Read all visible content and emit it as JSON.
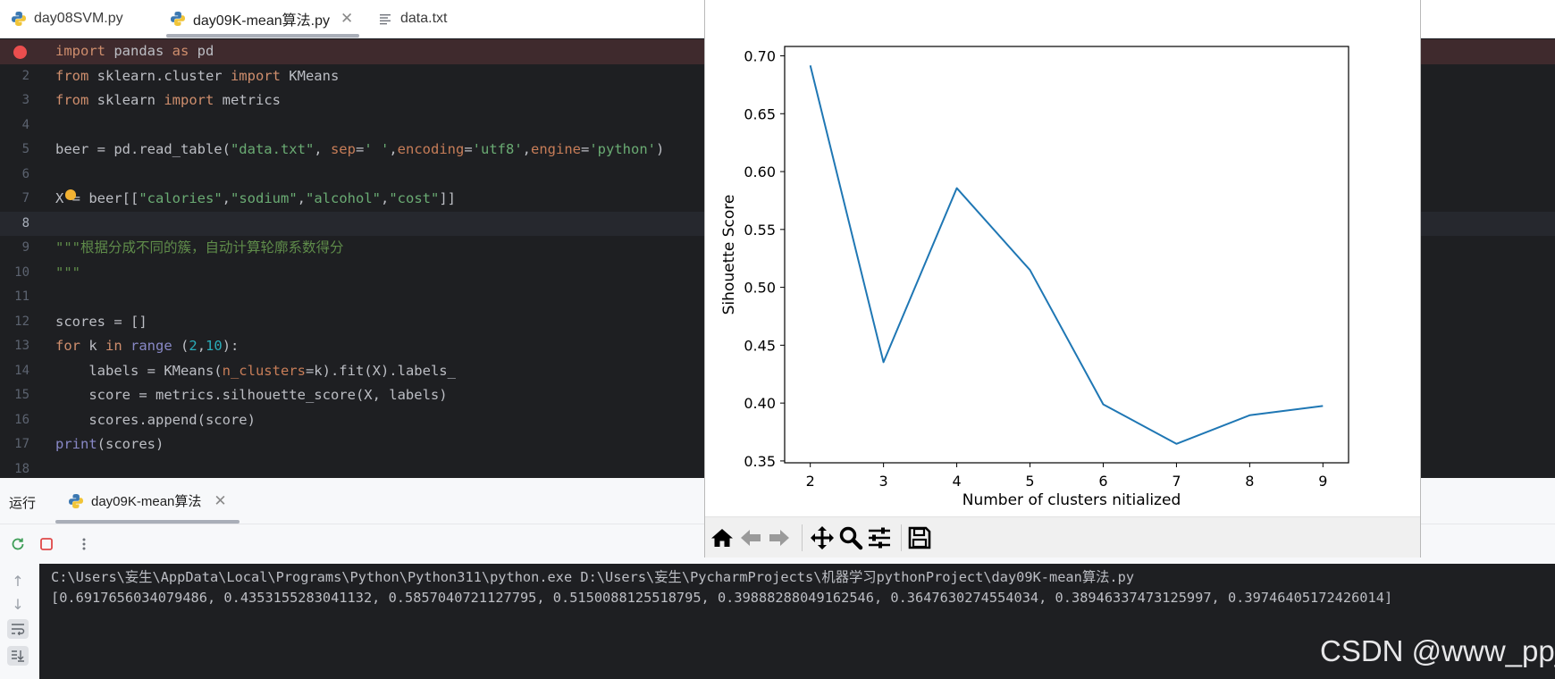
{
  "tabs": [
    {
      "label": "day08SVM.py",
      "icon": "python-file-icon",
      "active": false
    },
    {
      "label": "day09K-mean算法.py",
      "icon": "python-file-icon",
      "active": true
    },
    {
      "label": "data.txt",
      "icon": "text-file-icon",
      "active": false
    }
  ],
  "editor": {
    "line_numbers": [
      "2",
      "3",
      "4",
      "5",
      "6",
      "7",
      "8",
      "9",
      "10",
      "11",
      "12",
      "13",
      "14",
      "15",
      "16",
      "17",
      "18"
    ],
    "breakpoint_line": 1,
    "current_line": 8
  },
  "run_panel": {
    "title": "运行",
    "tab_label": "day09K-mean算法",
    "console": [
      "C:\\Users\\妄生\\AppData\\Local\\Programs\\Python\\Python311\\python.exe D:\\Users\\妄生\\PycharmProjects\\机器学习pythonProject\\day09K-mean算法.py",
      "[0.6917656034079486, 0.4353155283041132, 0.5857040721127795, 0.5150088125518795, 0.39888288049162546, 0.3647630274554034, 0.38946337473125997, 0.39746405172426014]"
    ]
  },
  "watermark": "CSDN @www_pp_",
  "colors": {
    "line_color": "#1f77b4",
    "breakpoint": "#ea4e4e",
    "keyword": "#cf8e6d",
    "string": "#6aab73"
  },
  "chart_data": {
    "type": "line",
    "xlabel": "Number of clusters nitialized",
    "ylabel": "Sihouette Score",
    "x": [
      2,
      3,
      4,
      5,
      6,
      7,
      8,
      9
    ],
    "y": [
      0.6917656034079486,
      0.4353155283041132,
      0.5857040721127795,
      0.5150088125518795,
      0.39888288049162546,
      0.3647630274554034,
      0.38946337473125997,
      0.39746405172426014
    ],
    "xticks": [
      "2",
      "3",
      "4",
      "5",
      "6",
      "7",
      "8",
      "9"
    ],
    "yticks": [
      "0.35",
      "0.40",
      "0.45",
      "0.50",
      "0.55",
      "0.60",
      "0.65",
      "0.70"
    ],
    "ytick_values": [
      0.35,
      0.4,
      0.45,
      0.5,
      0.55,
      0.6,
      0.65,
      0.7
    ],
    "xlim": [
      1.65,
      9.35
    ],
    "ylim": [
      0.3484,
      0.7081
    ],
    "grid": false
  },
  "figure_toolbar": [
    "home-icon",
    "back-icon",
    "forward-icon",
    "pan-icon",
    "zoom-icon",
    "configure-subplots-icon",
    "save-icon"
  ]
}
